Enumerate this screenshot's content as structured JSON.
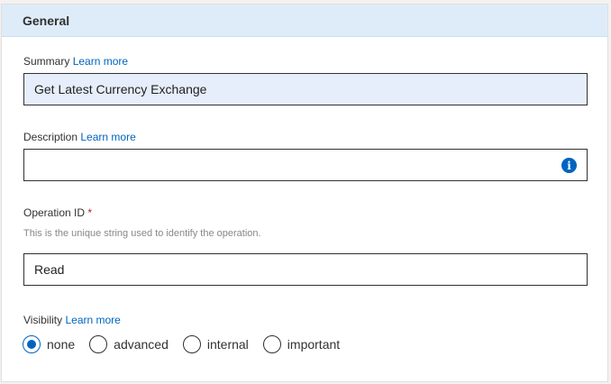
{
  "section": {
    "title": "General"
  },
  "summary": {
    "label": "Summary",
    "learn_more": "Learn more",
    "value": "Get Latest Currency Exchange"
  },
  "description": {
    "label": "Description",
    "learn_more": "Learn more",
    "value": "",
    "info_icon": "info-icon"
  },
  "operation_id": {
    "label": "Operation ID",
    "required_marker": "*",
    "hint": "This is the unique string used to identify the operation.",
    "value": "Read"
  },
  "visibility": {
    "label": "Visibility",
    "learn_more": "Learn more",
    "options": [
      {
        "label": "none",
        "selected": true
      },
      {
        "label": "advanced",
        "selected": false
      },
      {
        "label": "internal",
        "selected": false
      },
      {
        "label": "important",
        "selected": false
      }
    ]
  },
  "colors": {
    "accent": "#0064bf",
    "header_bg": "#deecf9",
    "filled_bg": "#e6eefb"
  }
}
